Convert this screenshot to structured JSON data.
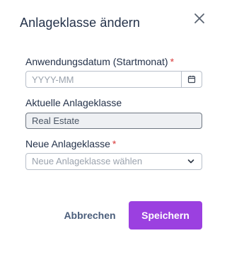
{
  "dialog": {
    "title": "Anlageklasse ändern"
  },
  "fields": {
    "start_date": {
      "label": "Anwendungsdatum (Startmonat)",
      "required_marker": "*",
      "placeholder": "YYYY-MM",
      "value": ""
    },
    "current_class": {
      "label": "Aktuelle Anlageklasse",
      "value": "Real Estate"
    },
    "new_class": {
      "label": "Neue Anlageklasse",
      "required_marker": "*",
      "placeholder": "Neue Anlageklasse wählen"
    }
  },
  "actions": {
    "cancel_label": "Abbrechen",
    "save_label": "Speichern"
  },
  "icons": {
    "close": "close-icon",
    "calendar": "calendar-icon",
    "dropdown": "chevron-down-icon"
  },
  "colors": {
    "primary": "#9b40e0",
    "required": "#d93a3a",
    "title": "#24324a",
    "cancel_text": "#4b5e7b",
    "readonly_bg": "#eef0f3"
  }
}
